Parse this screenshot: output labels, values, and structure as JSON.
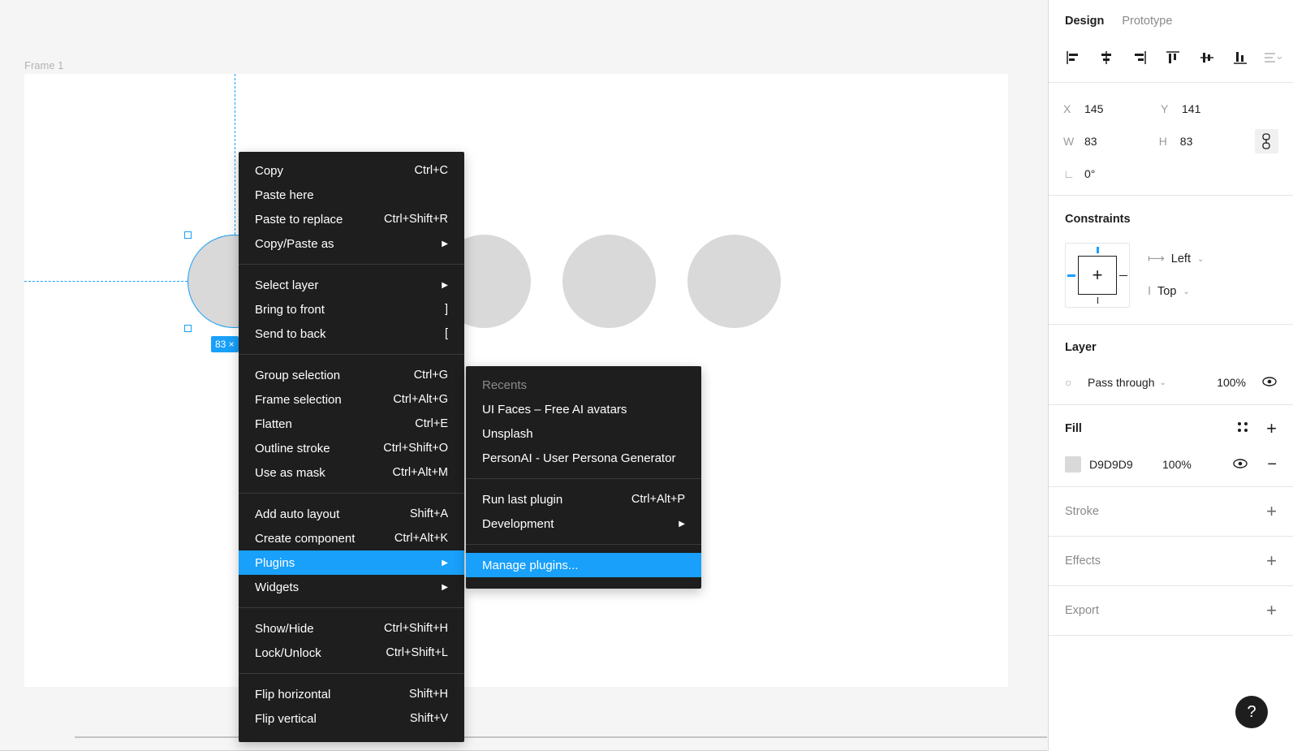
{
  "canvas": {
    "frame_label": "Frame 1",
    "size_badge": "83 ×"
  },
  "context_menu": {
    "groups": [
      [
        {
          "label": "Copy",
          "shortcut": "Ctrl+C"
        },
        {
          "label": "Paste here",
          "shortcut": ""
        },
        {
          "label": "Paste to replace",
          "shortcut": "Ctrl+Shift+R"
        },
        {
          "label": "Copy/Paste as",
          "shortcut": "",
          "submenu": true
        }
      ],
      [
        {
          "label": "Select layer",
          "shortcut": "",
          "submenu": true
        },
        {
          "label": "Bring to front",
          "shortcut": "]"
        },
        {
          "label": "Send to back",
          "shortcut": "["
        }
      ],
      [
        {
          "label": "Group selection",
          "shortcut": "Ctrl+G"
        },
        {
          "label": "Frame selection",
          "shortcut": "Ctrl+Alt+G"
        },
        {
          "label": "Flatten",
          "shortcut": "Ctrl+E"
        },
        {
          "label": "Outline stroke",
          "shortcut": "Ctrl+Shift+O"
        },
        {
          "label": "Use as mask",
          "shortcut": "Ctrl+Alt+M"
        }
      ],
      [
        {
          "label": "Add auto layout",
          "shortcut": "Shift+A"
        },
        {
          "label": "Create component",
          "shortcut": "Ctrl+Alt+K"
        },
        {
          "label": "Plugins",
          "shortcut": "",
          "submenu": true,
          "active": true
        },
        {
          "label": "Widgets",
          "shortcut": "",
          "submenu": true
        }
      ],
      [
        {
          "label": "Show/Hide",
          "shortcut": "Ctrl+Shift+H"
        },
        {
          "label": "Lock/Unlock",
          "shortcut": "Ctrl+Shift+L"
        }
      ],
      [
        {
          "label": "Flip horizontal",
          "shortcut": "Shift+H"
        },
        {
          "label": "Flip vertical",
          "shortcut": "Shift+V"
        }
      ]
    ]
  },
  "plugin_submenu": {
    "groups": [
      [
        {
          "label": "Recents",
          "shortcut": "",
          "disabled": true
        },
        {
          "label": "UI Faces – Free AI avatars",
          "shortcut": ""
        },
        {
          "label": "Unsplash",
          "shortcut": ""
        },
        {
          "label": "PersonAI - User Persona Generator",
          "shortcut": ""
        }
      ],
      [
        {
          "label": "Run last plugin",
          "shortcut": "Ctrl+Alt+P"
        },
        {
          "label": "Development",
          "shortcut": "",
          "submenu": true
        }
      ],
      [
        {
          "label": "Manage plugins...",
          "shortcut": "",
          "active": true
        }
      ]
    ]
  },
  "panel": {
    "tabs": [
      "Design",
      "Prototype"
    ],
    "x_label": "X",
    "x_value": "145",
    "y_label": "Y",
    "y_value": "141",
    "w_label": "W",
    "w_value": "83",
    "h_label": "H",
    "h_value": "83",
    "rotation_value": "0°",
    "constraints_title": "Constraints",
    "constraint_h": "Left",
    "constraint_v": "Top",
    "layer_title": "Layer",
    "blend_mode": "Pass through",
    "layer_opacity": "100%",
    "fill_title": "Fill",
    "fill_hex": "D9D9D9",
    "fill_opacity": "100%",
    "stroke_title": "Stroke",
    "effects_title": "Effects",
    "export_title": "Export",
    "help_label": "?"
  },
  "colors": {
    "accent": "#18a0fb",
    "menu_bg": "#1e1e1e",
    "shape_fill": "#D9D9D9"
  }
}
